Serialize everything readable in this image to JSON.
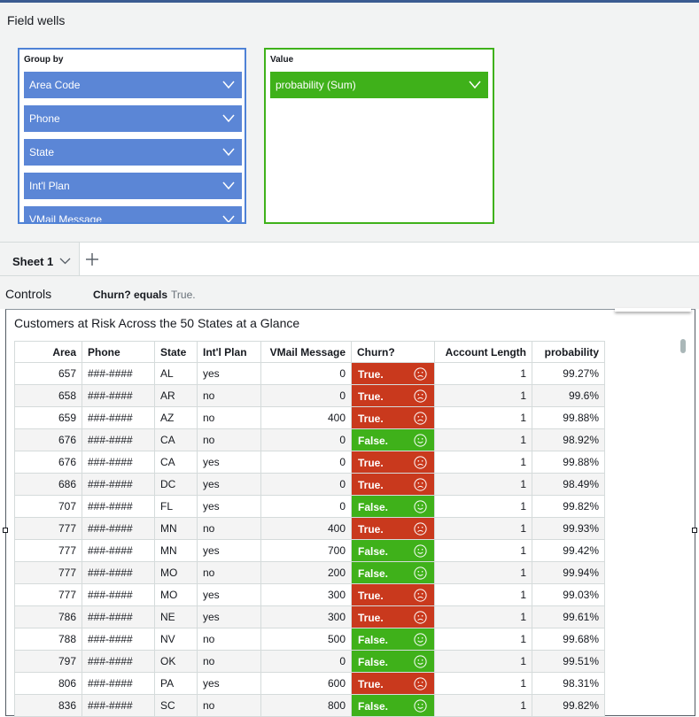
{
  "field_wells": {
    "title": "Field wells",
    "group_by": {
      "label": "Group by",
      "items": [
        "Area Code",
        "Phone",
        "State",
        "Int'l Plan",
        "VMail Message"
      ]
    },
    "value": {
      "label": "Value",
      "items": [
        "probability (Sum)"
      ]
    }
  },
  "sheets": {
    "active_tab": "Sheet 1"
  },
  "controls": {
    "title": "Controls",
    "filter_label": "Churn? equals",
    "filter_value": "True."
  },
  "visual": {
    "title": "Customers at Risk Across the 50 States at a Glance",
    "columns": [
      "Area",
      "Phone",
      "State",
      "Int'l Plan",
      "VMail Message",
      "Churn?",
      "Account Length",
      "probability"
    ],
    "rows": [
      [
        "657",
        "###-####",
        "AL",
        "yes",
        "0",
        "True.",
        "1",
        "99.27%"
      ],
      [
        "658",
        "###-####",
        "AR",
        "no",
        "0",
        "True.",
        "1",
        "99.6%"
      ],
      [
        "659",
        "###-####",
        "AZ",
        "no",
        "400",
        "True.",
        "1",
        "99.88%"
      ],
      [
        "676",
        "###-####",
        "CA",
        "no",
        "0",
        "False.",
        "1",
        "98.92%"
      ],
      [
        "676",
        "###-####",
        "CA",
        "yes",
        "0",
        "True.",
        "1",
        "99.88%"
      ],
      [
        "686",
        "###-####",
        "DC",
        "yes",
        "0",
        "True.",
        "1",
        "98.49%"
      ],
      [
        "707",
        "###-####",
        "FL",
        "yes",
        "0",
        "False.",
        "1",
        "99.82%"
      ],
      [
        "777",
        "###-####",
        "MN",
        "no",
        "400",
        "True.",
        "1",
        "99.93%"
      ],
      [
        "777",
        "###-####",
        "MN",
        "yes",
        "700",
        "False.",
        "1",
        "99.42%"
      ],
      [
        "777",
        "###-####",
        "MO",
        "no",
        "200",
        "False.",
        "1",
        "99.94%"
      ],
      [
        "777",
        "###-####",
        "MO",
        "yes",
        "300",
        "True.",
        "1",
        "99.03%"
      ],
      [
        "786",
        "###-####",
        "NE",
        "yes",
        "300",
        "True.",
        "1",
        "99.61%"
      ],
      [
        "788",
        "###-####",
        "NV",
        "no",
        "500",
        "False.",
        "1",
        "99.68%"
      ],
      [
        "797",
        "###-####",
        "OK",
        "no",
        "0",
        "False.",
        "1",
        "99.51%"
      ],
      [
        "806",
        "###-####",
        "PA",
        "yes",
        "600",
        "True.",
        "1",
        "98.31%"
      ],
      [
        "836",
        "###-####",
        "SC",
        "no",
        "800",
        "False.",
        "1",
        "99.82%"
      ]
    ]
  },
  "colors": {
    "group_by_well": "#5b86d6",
    "value_well": "#3fb11a",
    "churn_true": "#c9391d",
    "churn_false": "#3fb11a"
  },
  "icons": {
    "churn_true": "frown-icon",
    "churn_false": "smile-icon",
    "dropdown": "chevron-down-icon",
    "add_sheet": "plus-icon"
  }
}
